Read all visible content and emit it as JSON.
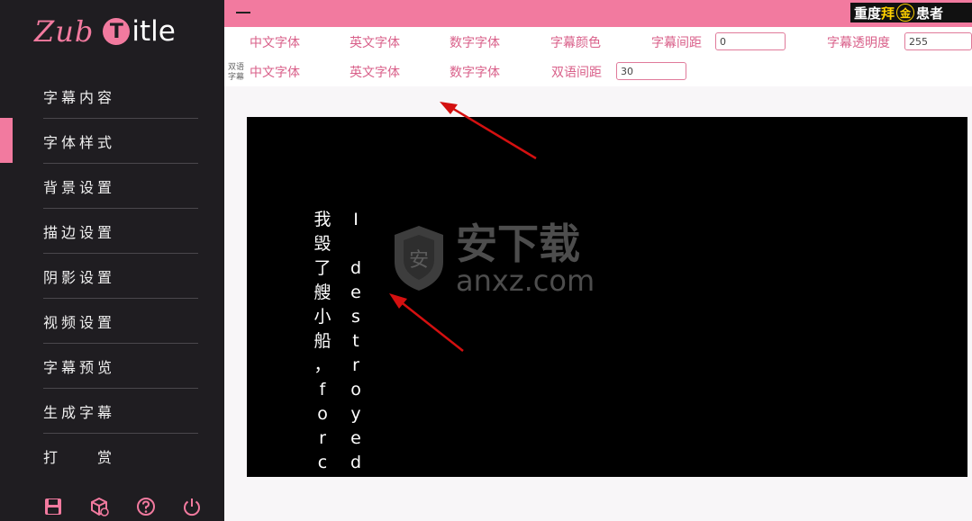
{
  "app": {
    "logo_left": "Zub",
    "logo_circle": "T",
    "logo_right": "itle"
  },
  "sidebar": {
    "items": [
      {
        "label": "字幕内容"
      },
      {
        "label": "字体样式"
      },
      {
        "label": "背景设置"
      },
      {
        "label": "描边设置"
      },
      {
        "label": "阴影设置"
      },
      {
        "label": "视频设置"
      },
      {
        "label": "字幕预览"
      },
      {
        "label": "生成字幕"
      }
    ],
    "reward": {
      "a": "打",
      "b": "赏"
    },
    "active_index": 1,
    "icons": [
      "save-icon",
      "cube-icon",
      "help-icon",
      "power-icon"
    ]
  },
  "banner": {
    "p1": "重度",
    "p2": "拜",
    "p3": "金",
    "p4": "患者"
  },
  "toolbar": {
    "row1": {
      "cn_font": "中文字体",
      "en_font": "英文字体",
      "num_font": "数字字体",
      "color": "字幕颜色",
      "spacing": "字幕间距",
      "spacing_value": "0",
      "opacity": "字幕透明度",
      "opacity_value": "255"
    },
    "row2": {
      "tag_line1": "双语",
      "tag_line2": "字幕",
      "cn_font": "中文字体",
      "en_font": "英文字体",
      "num_font": "数字字体",
      "bi_spacing": "双语间距",
      "bi_spacing_value": "30"
    }
  },
  "preview": {
    "cn_chars": [
      "我",
      "毁",
      "了",
      "艘",
      "小",
      "船",
      "，",
      "f",
      "o",
      "r",
      "c"
    ],
    "en_chars": [
      "I",
      "",
      "d",
      "e",
      "s",
      "t",
      "r",
      "o",
      "y",
      "e",
      "d"
    ],
    "watermark_cn": "安下载",
    "watermark_en": "anxz.com",
    "watermark_shield": "安"
  },
  "colors": {
    "accent": "#f27a9f",
    "sidebar_bg": "#1f1d21",
    "label_pink": "#d9608a",
    "preview_bg": "#000000"
  }
}
